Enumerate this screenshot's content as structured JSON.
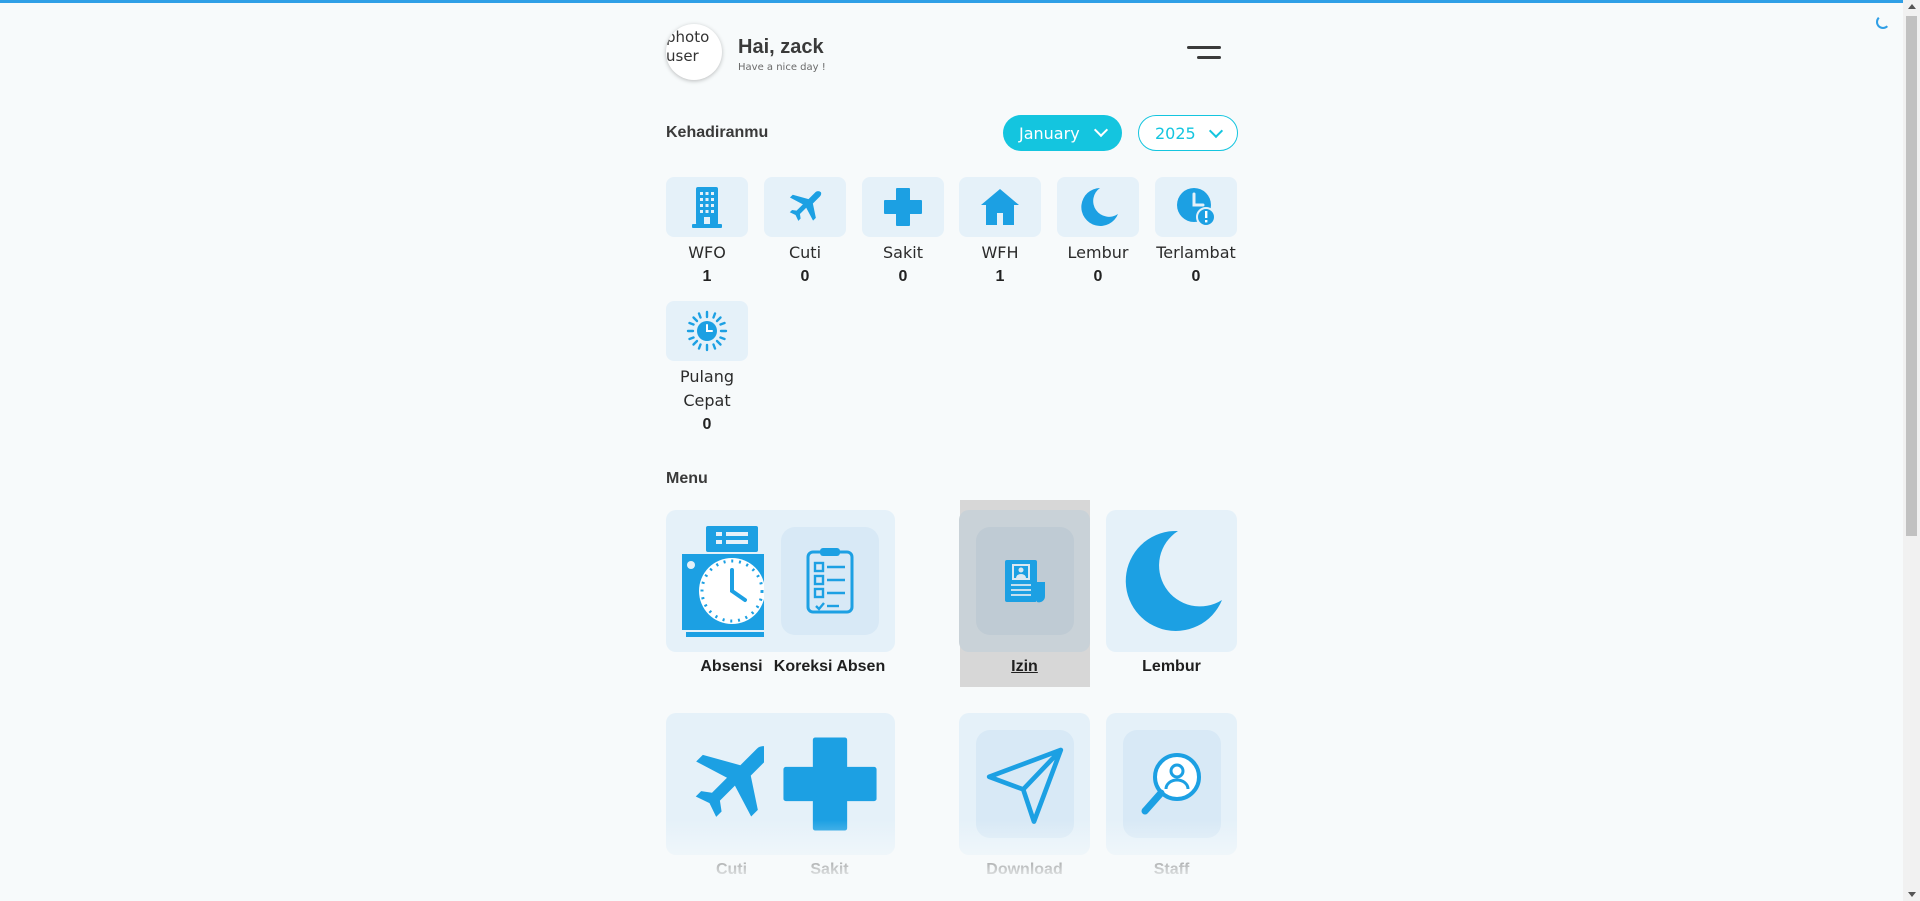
{
  "header": {
    "avatar_alt": "photo user",
    "greeting": "Hai, zack",
    "subtitle": "Have a nice day !"
  },
  "attendance": {
    "title": "Kehadiranmu",
    "month": "January",
    "year": "2025",
    "stats": [
      {
        "label": "WFO",
        "count": "1",
        "icon": "office-building-icon"
      },
      {
        "label": "Cuti",
        "count": "0",
        "icon": "airplane-icon"
      },
      {
        "label": "Sakit",
        "count": "0",
        "icon": "medical-cross-icon"
      },
      {
        "label": "WFH",
        "count": "1",
        "icon": "house-icon"
      },
      {
        "label": "Lembur",
        "count": "0",
        "icon": "moon-icon"
      },
      {
        "label": "Terlambat",
        "count": "0",
        "icon": "clock-alert-icon"
      },
      {
        "label": "Pulang Cepat",
        "count": "0",
        "icon": "sun-clock-icon"
      }
    ]
  },
  "menu": {
    "title": "Menu",
    "items": [
      {
        "label": "Absensi",
        "icon": "time-clock-icon"
      },
      {
        "label": "Koreksi Absen",
        "icon": "clipboard-checklist-icon"
      },
      {
        "label": "Izin",
        "icon": "permission-document-icon"
      },
      {
        "label": "Lembur",
        "icon": "moon-icon"
      },
      {
        "label": "Cuti",
        "icon": "airplane-icon"
      },
      {
        "label": "Sakit",
        "icon": "medical-cross-icon"
      },
      {
        "label": "Download",
        "icon": "paper-plane-icon"
      },
      {
        "label": "Staff",
        "icon": "staff-search-icon"
      }
    ]
  },
  "colors": {
    "accent": "#14c5df",
    "icon_blue": "#1ca0e3",
    "progress_bar": "#2f9fe6",
    "tile_bg": "#e5f1f9"
  }
}
